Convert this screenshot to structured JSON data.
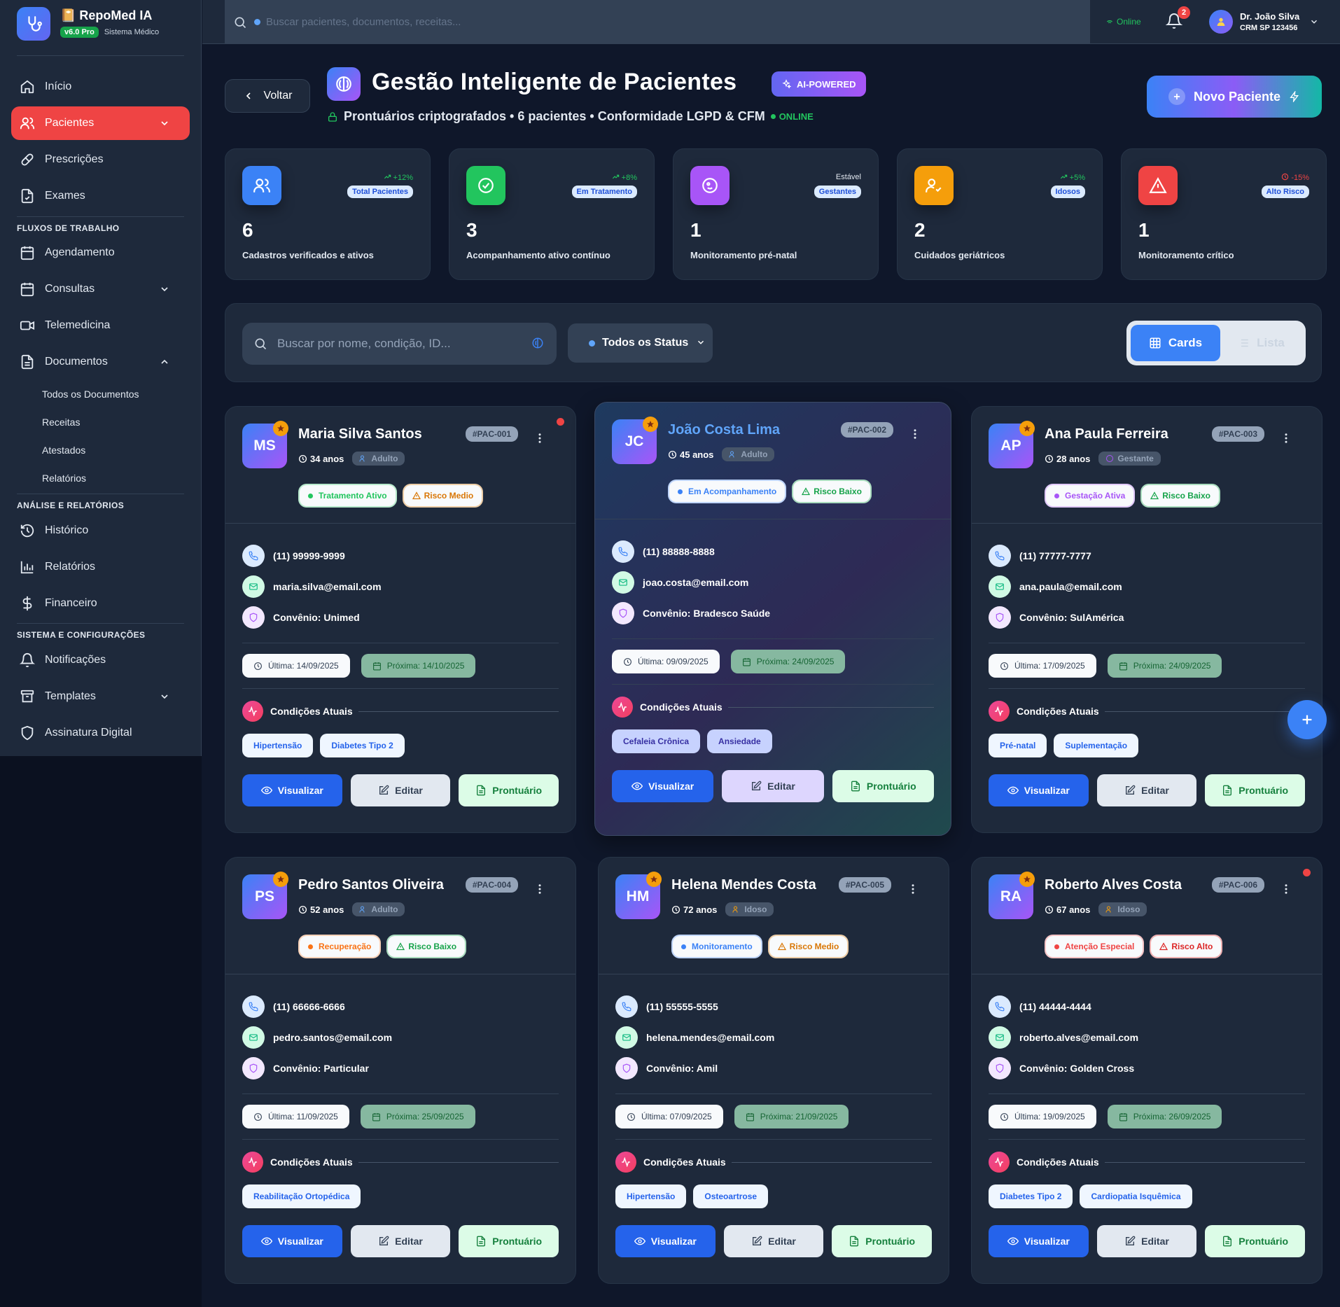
{
  "app": {
    "name": "RepoMed IA",
    "version": "v6.0 Pro",
    "subtitle": "Sistema Médico"
  },
  "sidebar": {
    "items": [
      {
        "label": "Início",
        "icon": "home-icon"
      },
      {
        "label": "Pacientes",
        "icon": "users-icon",
        "active": true
      },
      {
        "label": "Prescrições",
        "icon": "pill-icon"
      },
      {
        "label": "Exames",
        "icon": "file-check-icon"
      }
    ],
    "workflow_title": "FLUXOS DE TRABALHO",
    "workflow": [
      {
        "label": "Agendamento",
        "icon": "calendar-icon"
      },
      {
        "label": "Consultas",
        "icon": "calendar-icon"
      },
      {
        "label": "Telemedicina",
        "icon": "video-icon"
      },
      {
        "label": "Documentos",
        "icon": "document-icon"
      }
    ],
    "documents_sub": [
      "Todos os Documentos",
      "Receitas",
      "Atestados",
      "Relatórios"
    ],
    "analysis_title": "ANÁLISE E RELATÓRIOS",
    "analysis": [
      {
        "label": "Histórico",
        "icon": "history-icon"
      },
      {
        "label": "Relatórios",
        "icon": "bar-chart-icon"
      },
      {
        "label": "Financeiro",
        "icon": "dollar-icon"
      }
    ],
    "system_title": "SISTEMA E CONFIGURAÇÕES",
    "system": [
      {
        "label": "Notificações",
        "icon": "bell-icon"
      },
      {
        "label": "Templates",
        "icon": "archive-icon"
      },
      {
        "label": "Assinatura Digital",
        "icon": "shield-icon"
      }
    ]
  },
  "topbar": {
    "search_placeholder": "Buscar pacientes, documentos, receitas...",
    "status": "Online",
    "notifications_count": "2",
    "user_name": "Dr. João Silva",
    "user_crm": "CRM SP 123456"
  },
  "header": {
    "back_label": "Voltar",
    "title": "Gestão Inteligente de Pacientes",
    "ai_badge": "AI-POWERED",
    "subtitle": "Prontuários criptografados • 6 pacientes • Conformidade LGPD & CFM",
    "online": "ONLINE",
    "new_patient": "Novo Paciente"
  },
  "stats": [
    {
      "trend": "+12%",
      "label": "Total Pacientes",
      "value": "6",
      "desc": "Cadastros verificados e ativos",
      "color": "#3b82f6",
      "trend_color": "#22c55e",
      "label_bg": "#dbeafe",
      "label_fg": "#1d4ed8"
    },
    {
      "trend": "+8%",
      "label": "Em Tratamento",
      "value": "3",
      "desc": "Acompanhamento ativo contínuo",
      "color": "#22c55e",
      "trend_color": "#22c55e",
      "label_bg": "#dbeafe",
      "label_fg": "#1d4ed8"
    },
    {
      "trend": "Estável",
      "label": "Gestantes",
      "value": "1",
      "desc": "Monitoramento pré-natal",
      "color": "#a855f7",
      "trend_color": "#e2e8f0",
      "label_bg": "#dbeafe",
      "label_fg": "#1d4ed8"
    },
    {
      "trend": "+5%",
      "label": "Idosos",
      "value": "2",
      "desc": "Cuidados geriátricos",
      "color": "#f59e0b",
      "trend_color": "#22c55e",
      "label_bg": "#dbeafe",
      "label_fg": "#1d4ed8"
    },
    {
      "trend": "-15%",
      "label": "Alto Risco",
      "value": "1",
      "desc": "Monitoramento crítico",
      "color": "#ef4444",
      "trend_color": "#ef4444",
      "label_bg": "#dbeafe",
      "label_fg": "#1d4ed8"
    }
  ],
  "filters": {
    "search_placeholder": "Buscar por nome, condição, ID...",
    "status": "Todos os Status",
    "view_cards": "Cards",
    "view_list": "Lista"
  },
  "labels": {
    "conditions": "Condições Atuais",
    "view": "Visualizar",
    "edit": "Editar",
    "record": "Prontuário"
  },
  "patients": [
    {
      "initials": "MS",
      "name": "Maria Silva Santos",
      "id": "#PAC-001",
      "age": "34 anos",
      "age_group": "Adulto",
      "status": "Tratamento Ativo",
      "status_color": "#22c55e",
      "risk": "Risco Medio",
      "risk_color": "#d97706",
      "phone": "(11) 99999-9999",
      "email": "maria.silva@email.com",
      "insurance": "Convênio: Unimed",
      "last": "Última: 14/09/2025",
      "next": "Próxima: 14/10/2025",
      "conditions": [
        "Hipertensão",
        "Diabetes Tipo 2"
      ],
      "alert": true
    },
    {
      "initials": "JC",
      "name": "João Costa Lima",
      "id": "#PAC-002",
      "age": "45 anos",
      "age_group": "Adulto",
      "status": "Em Acompanhamento",
      "status_color": "#3b82f6",
      "risk": "Risco Baixo",
      "risk_color": "#16a34a",
      "phone": "(11) 88888-8888",
      "email": "joao.costa@email.com",
      "insurance": "Convênio: Bradesco Saúde",
      "last": "Última: 09/09/2025",
      "next": "Próxima: 24/09/2025",
      "conditions": [
        "Cefaleia Crônica",
        "Ansiedade"
      ],
      "alert": false
    },
    {
      "initials": "AP",
      "name": "Ana Paula Ferreira",
      "id": "#PAC-003",
      "age": "28 anos",
      "age_group": "Gestante",
      "status": "Gestação Ativa",
      "status_color": "#a855f7",
      "risk": "Risco Baixo",
      "risk_color": "#16a34a",
      "phone": "(11) 77777-7777",
      "email": "ana.paula@email.com",
      "insurance": "Convênio: SulAmérica",
      "last": "Última: 17/09/2025",
      "next": "Próxima: 24/09/2025",
      "conditions": [
        "Pré-natal",
        "Suplementação"
      ],
      "alert": false
    },
    {
      "initials": "PS",
      "name": "Pedro Santos Oliveira",
      "id": "#PAC-004",
      "age": "52 anos",
      "age_group": "Adulto",
      "status": "Recuperação",
      "status_color": "#f97316",
      "risk": "Risco Baixo",
      "risk_color": "#16a34a",
      "phone": "(11) 66666-6666",
      "email": "pedro.santos@email.com",
      "insurance": "Convênio: Particular",
      "last": "Última: 11/09/2025",
      "next": "Próxima: 25/09/2025",
      "conditions": [
        "Reabilitação Ortopédica"
      ],
      "alert": false
    },
    {
      "initials": "HM",
      "name": "Helena Mendes Costa",
      "id": "#PAC-005",
      "age": "72 anos",
      "age_group": "Idoso",
      "status": "Monitoramento",
      "status_color": "#3b82f6",
      "risk": "Risco Medio",
      "risk_color": "#d97706",
      "phone": "(11) 55555-5555",
      "email": "helena.mendes@email.com",
      "insurance": "Convênio: Amil",
      "last": "Última: 07/09/2025",
      "next": "Próxima: 21/09/2025",
      "conditions": [
        "Hipertensão",
        "Osteoartrose"
      ],
      "alert": false
    },
    {
      "initials": "RA",
      "name": "Roberto Alves Costa",
      "id": "#PAC-006",
      "age": "67 anos",
      "age_group": "Idoso",
      "status": "Atenção Especial",
      "status_color": "#ef4444",
      "risk": "Risco Alto",
      "risk_color": "#dc2626",
      "phone": "(11) 44444-4444",
      "email": "roberto.alves@email.com",
      "insurance": "Convênio: Golden Cross",
      "last": "Última: 19/09/2025",
      "next": "Próxima: 26/09/2025",
      "conditions": [
        "Diabetes Tipo 2",
        "Cardiopatia Isquêmica"
      ],
      "alert": true
    }
  ]
}
